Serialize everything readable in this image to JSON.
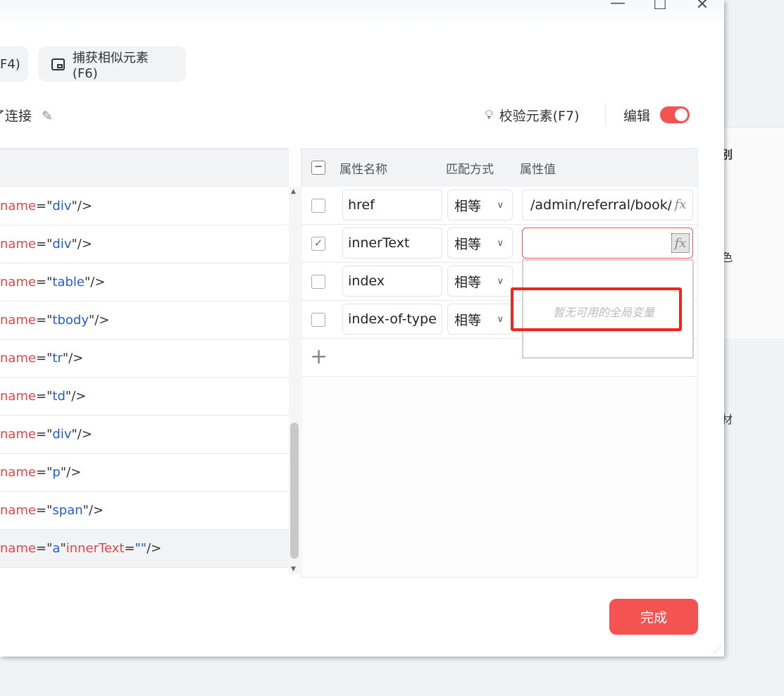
{
  "background": {
    "texts": [
      "别",
      "色",
      "材"
    ]
  },
  "window": {
    "controls": {
      "minimize": "—",
      "maximize": "☐",
      "close": "✕"
    }
  },
  "toolbar": {
    "prev_button": "F4)",
    "capture_similar": "捕获相似元素(F6)"
  },
  "element_name": "了连接",
  "verify_button": "校验元素(F7)",
  "edit_label": "编辑",
  "edit_enabled": true,
  "tree": {
    "rows": [
      {
        "name": "div",
        "extra": ""
      },
      {
        "name": "div",
        "extra": ""
      },
      {
        "name": "table",
        "extra": ""
      },
      {
        "name": "tbody",
        "extra": ""
      },
      {
        "name": "tr",
        "extra": ""
      },
      {
        "name": "td",
        "extra": ""
      },
      {
        "name": "div",
        "extra": ""
      },
      {
        "name": "p",
        "extra": ""
      },
      {
        "name": "span",
        "extra": ""
      },
      {
        "name": "a",
        "extra": "innerText"
      }
    ],
    "attr_key": "name",
    "close": "/>",
    "equals": "=\"",
    "quote": "\"",
    "empty_value": "\"\""
  },
  "attributes": {
    "headers": {
      "name": "属性名称",
      "match": "匹配方式",
      "value": "属性值"
    },
    "rows": [
      {
        "checked": false,
        "name": "href",
        "match": "相等",
        "value": "/admin/referral/book/"
      },
      {
        "checked": true,
        "name": "innerText",
        "match": "相等",
        "value": ""
      },
      {
        "checked": false,
        "name": "index",
        "match": "相等",
        "value": ""
      },
      {
        "checked": false,
        "name": "index-of-type",
        "match": "相等",
        "value": ""
      }
    ],
    "fx_label": "fx",
    "add_icon": "+"
  },
  "dropdown": {
    "empty_text": "暂无可用的全局变量"
  },
  "done_button": "完成"
}
